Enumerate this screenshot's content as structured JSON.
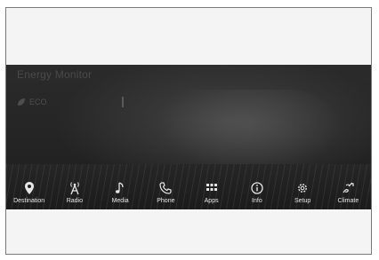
{
  "screen": {
    "title": "Energy Monitor",
    "eco_label": "ECO"
  },
  "nav": {
    "items": [
      {
        "label": "Destination",
        "icon": "map-pin-icon"
      },
      {
        "label": "Radio",
        "icon": "antenna-icon"
      },
      {
        "label": "Media",
        "icon": "music-note-icon"
      },
      {
        "label": "Phone",
        "icon": "phone-icon"
      },
      {
        "label": "Apps",
        "icon": "apps-grid-icon"
      },
      {
        "label": "Info",
        "icon": "info-icon"
      },
      {
        "label": "Setup",
        "icon": "gear-icon"
      },
      {
        "label": "Climate",
        "icon": "climate-icon"
      }
    ]
  },
  "colors": {
    "screen_bg": "#242424",
    "nav_text": "#e6e6e6"
  }
}
